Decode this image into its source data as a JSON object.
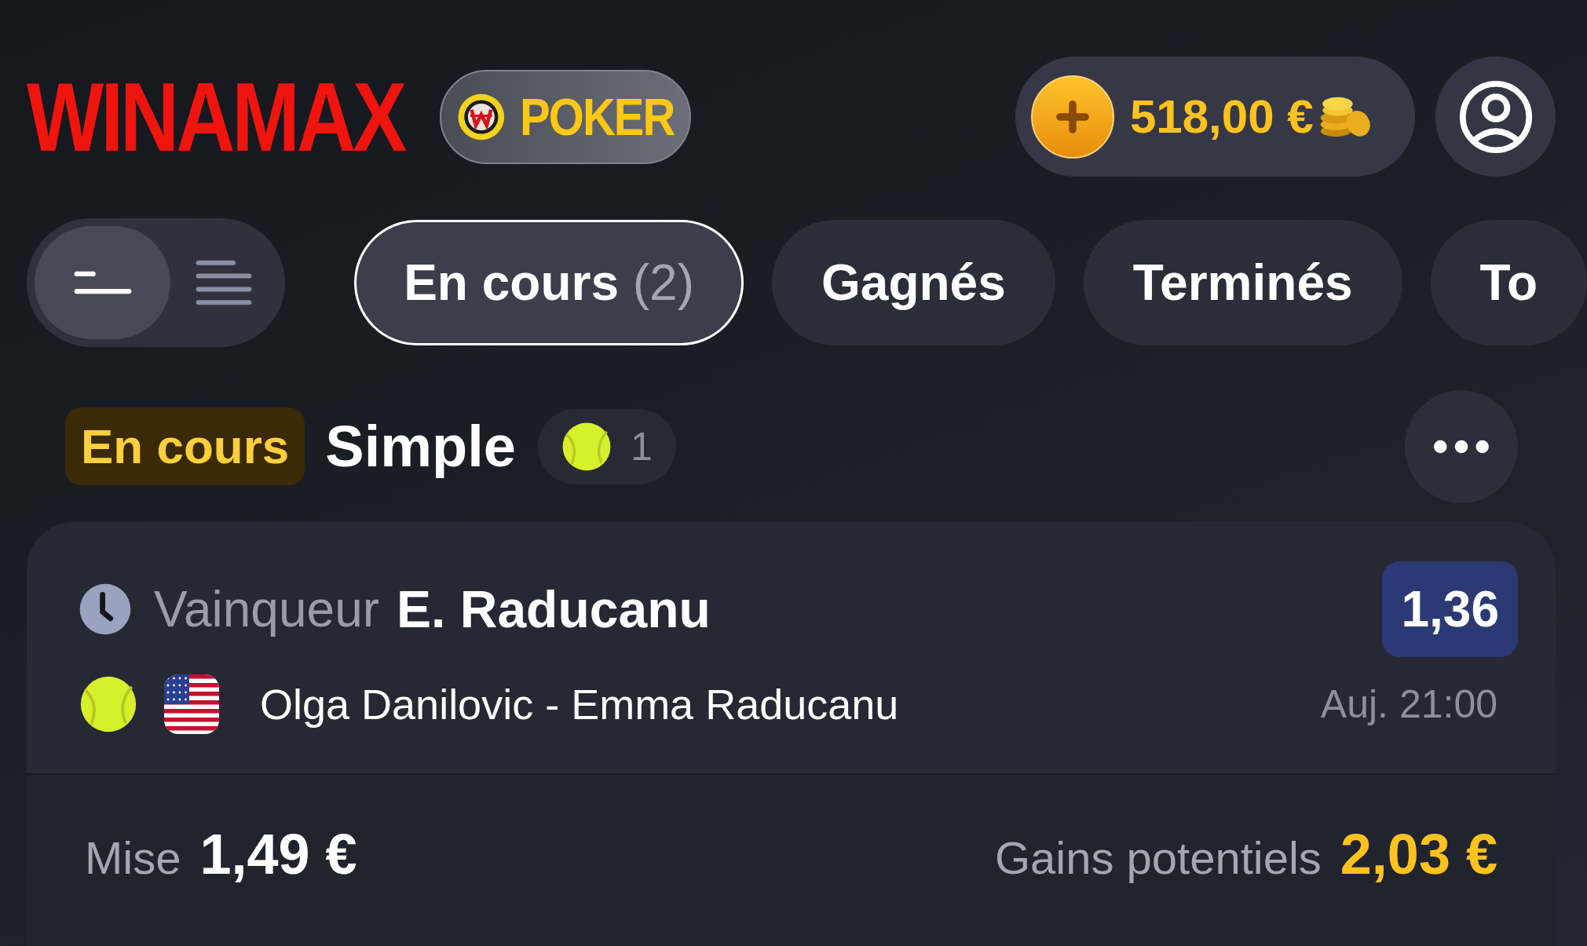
{
  "logo": {
    "text": "WINAMAX"
  },
  "poker_button": {
    "label": "POKER"
  },
  "balance": {
    "amount": "518,00 €"
  },
  "view_toggle": [
    {
      "kind": "compact",
      "selected": true
    },
    {
      "kind": "list",
      "selected": false
    }
  ],
  "tabs": [
    {
      "label": "En cours",
      "count": "(2)",
      "selected": true
    },
    {
      "label": "Gagnés",
      "selected": false
    },
    {
      "label": "Terminés",
      "selected": false
    },
    {
      "label": "To",
      "selected": false
    }
  ],
  "bet": {
    "status": "En cours",
    "type": "Simple",
    "sport_count": "1",
    "selections": [
      {
        "market": "Vainqueur",
        "pick": "E. Raducanu",
        "odds": "1,36",
        "match": "Olga Danilovic - Emma Raducanu",
        "time": "Auj. 21:00"
      }
    ],
    "stake_label": "Mise",
    "stake": "1,49 €",
    "winnings_label": "Gains potentiels",
    "winnings": "2,03 €"
  }
}
